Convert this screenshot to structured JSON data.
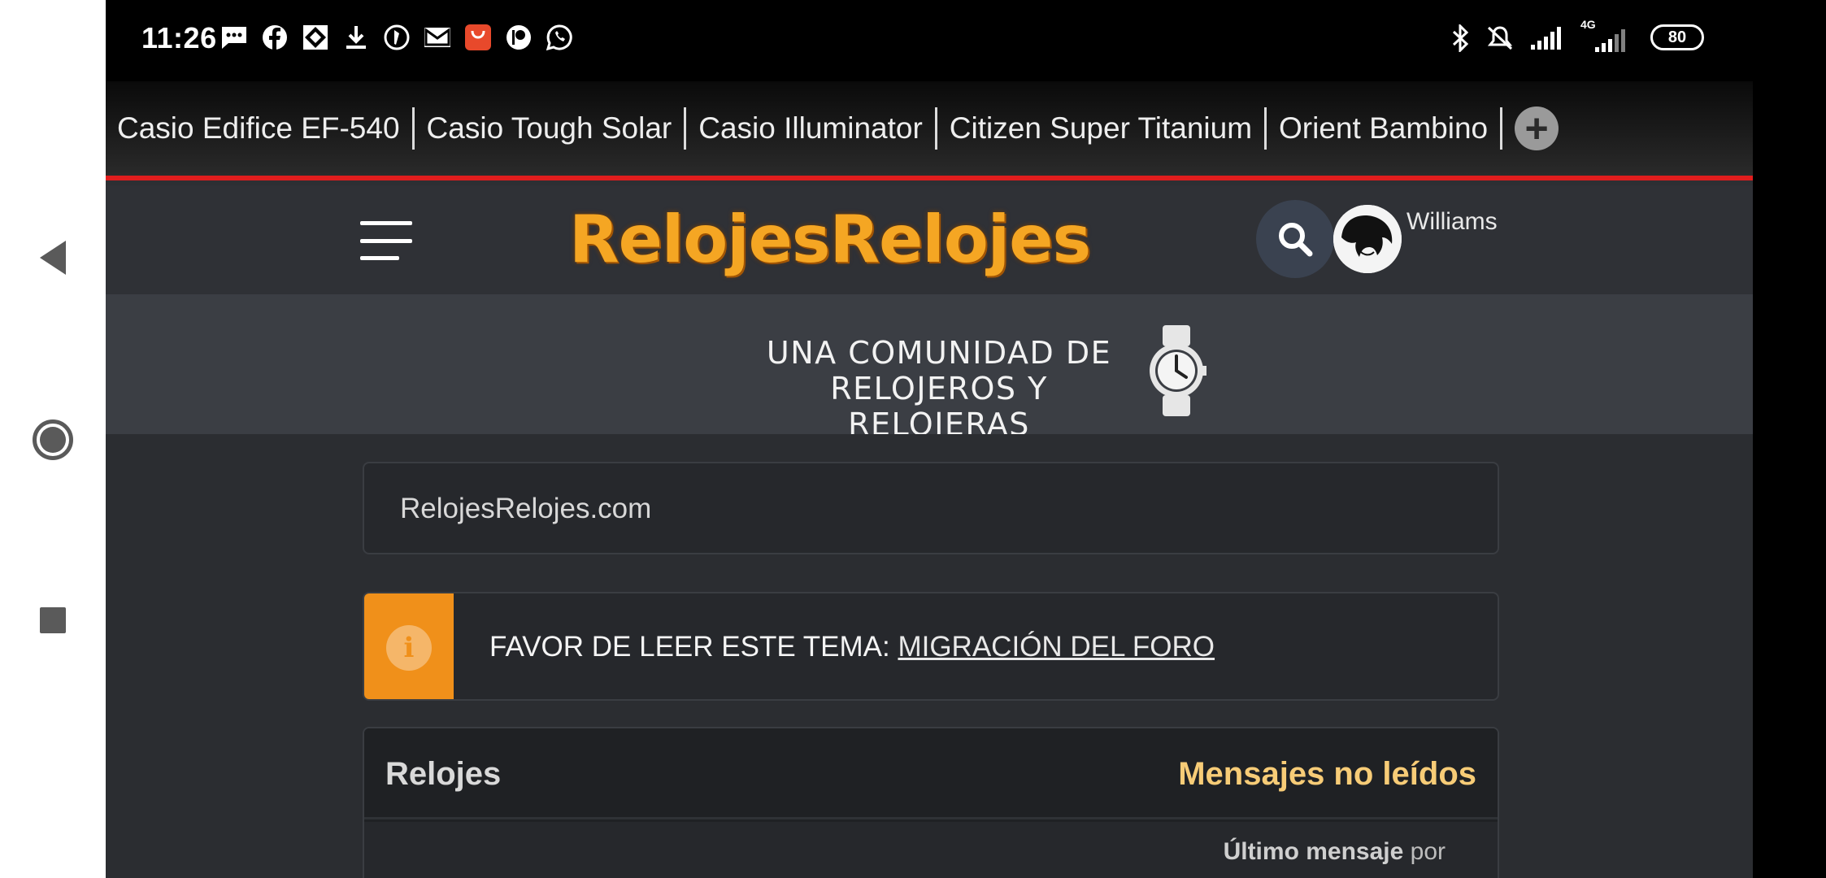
{
  "status_bar": {
    "time": "11:26",
    "notification_icons": [
      "message-icon",
      "facebook-icon",
      "photos-icon",
      "download-icon",
      "maps-icon",
      "gmail-icon",
      "aliexpress-icon",
      "patreon-icon",
      "whatsapp-icon"
    ],
    "system_icons": [
      "bluetooth-icon",
      "mute-icon",
      "signal-icon",
      "4g-signal-icon"
    ],
    "network_label": "4G",
    "battery": "80"
  },
  "tabs": [
    {
      "label": "Casio Edifice EF-540"
    },
    {
      "label": "Casio Tough Solar"
    },
    {
      "label": "Casio Illuminator"
    },
    {
      "label": "Citizen Super Titanium"
    },
    {
      "label": "Orient Bambino"
    }
  ],
  "tab_add_label": "+",
  "header": {
    "logo": "RelojesRelojes",
    "username": "Williams",
    "accent_color": "#f5a623"
  },
  "banner": {
    "line1": "UNA COMUNIDAD DE",
    "line2": "RELOJEROS Y RELOJERAS"
  },
  "breadcrumb": "RelojesRelojes.com",
  "notice": {
    "prefix": "FAVOR DE LEER ESTE TEMA: ",
    "link": "MIGRACIÓN DEL FORO",
    "icon": "info-icon"
  },
  "forum": {
    "title": "Relojes",
    "unread_label": "Mensajes no leídos",
    "last_message_bold": "Último mensaje",
    "last_message_suffix": " por"
  }
}
